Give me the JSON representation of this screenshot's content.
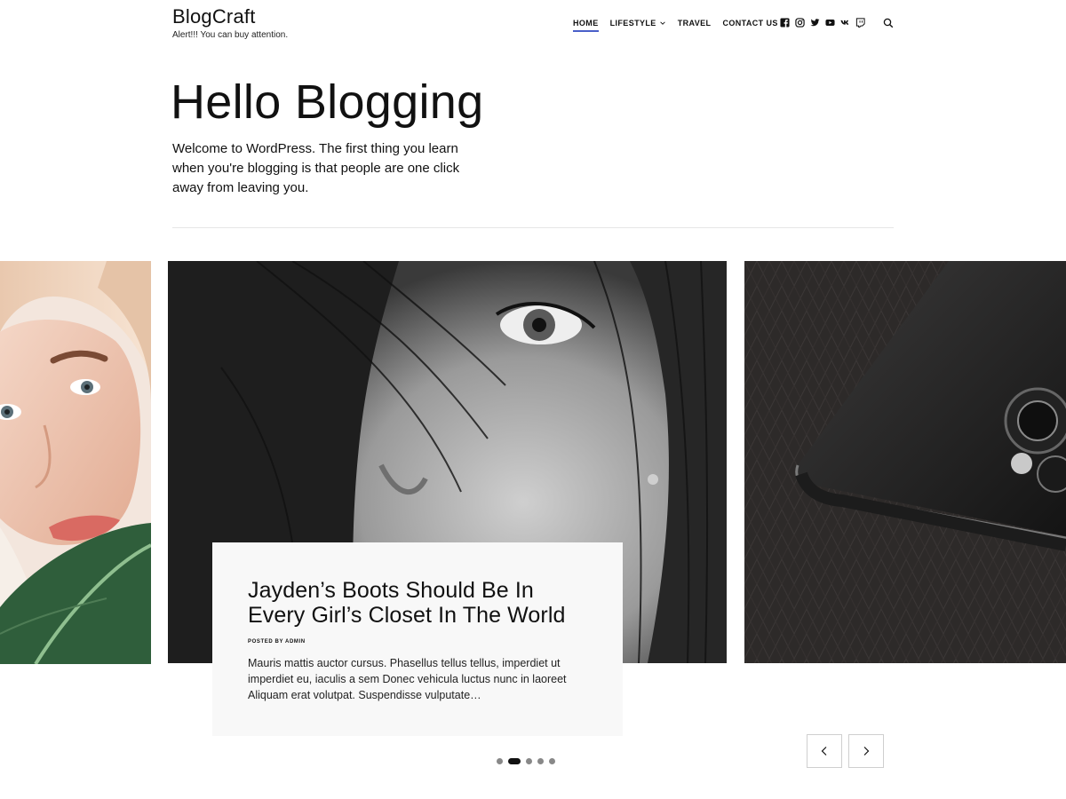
{
  "site": {
    "title": "BlogCraft",
    "tagline": "Alert!!! You can buy attention."
  },
  "nav": {
    "items": [
      {
        "label": "HOME",
        "active": true
      },
      {
        "label": "LIFESTYLE",
        "has_dropdown": true
      },
      {
        "label": "TRAVEL"
      },
      {
        "label": "CONTACT US"
      }
    ],
    "accent_color": "#4a5fc9"
  },
  "socials": [
    "facebook-icon",
    "instagram-icon",
    "twitter-icon",
    "youtube-icon",
    "vk-icon",
    "twitch-icon"
  ],
  "search": {
    "icon": "search-icon"
  },
  "hero": {
    "title": "Hello Blogging",
    "intro": "Welcome to WordPress. The first thing you learn when you're blogging is that people are one click away from leaving you."
  },
  "slider": {
    "slides": [
      "woman-with-leaf-photo",
      "black-and-white-portrait-photo",
      "smartphone-closeup-photo"
    ],
    "card": {
      "title": "Jayden’s Boots Should Be In Every Girl’s Closet In The World",
      "meta_prefix": "POSTED BY",
      "meta_author": "ADMIN",
      "excerpt": "Mauris mattis auctor cursus. Phasellus tellus tellus, imperdiet ut imperdiet eu, iaculis a sem Donec vehicula luctus nunc in laoreet Aliquam erat volutpat. Suspendisse vulputate…"
    },
    "dots_count": 5,
    "active_dot": 1,
    "prev_icon": "chevron-left-icon",
    "next_icon": "chevron-right-icon"
  }
}
